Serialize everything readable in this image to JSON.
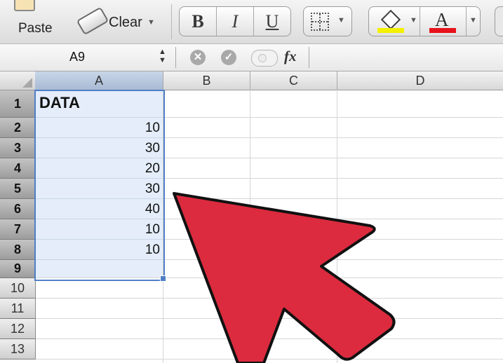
{
  "toolbar": {
    "paste_label": "Paste",
    "clear_label": "Clear",
    "bold_label": "B",
    "italic_label": "I",
    "underline_label": "U",
    "font_color_glyph": "A",
    "fill_color": "#f4f000",
    "font_color": "#e8121c"
  },
  "formula_bar": {
    "name_box": "A9",
    "fx_label": "fx",
    "cancel_icon": "cancel-icon",
    "confirm_icon": "confirm-icon"
  },
  "sheet": {
    "columns": [
      "A",
      "B",
      "C",
      "D"
    ],
    "rows": [
      "1",
      "2",
      "3",
      "4",
      "5",
      "6",
      "7",
      "8",
      "9",
      "10",
      "11",
      "12",
      "13"
    ],
    "selected_range": "A1:A9",
    "cells": {
      "A1": "DATA",
      "A2": "10",
      "A3": "30",
      "A4": "20",
      "A5": "30",
      "A6": "40",
      "A7": "10",
      "A8": "10"
    }
  },
  "overlay": {
    "pointer": "red-arrow-pointer",
    "color": "#dc2b3e"
  }
}
